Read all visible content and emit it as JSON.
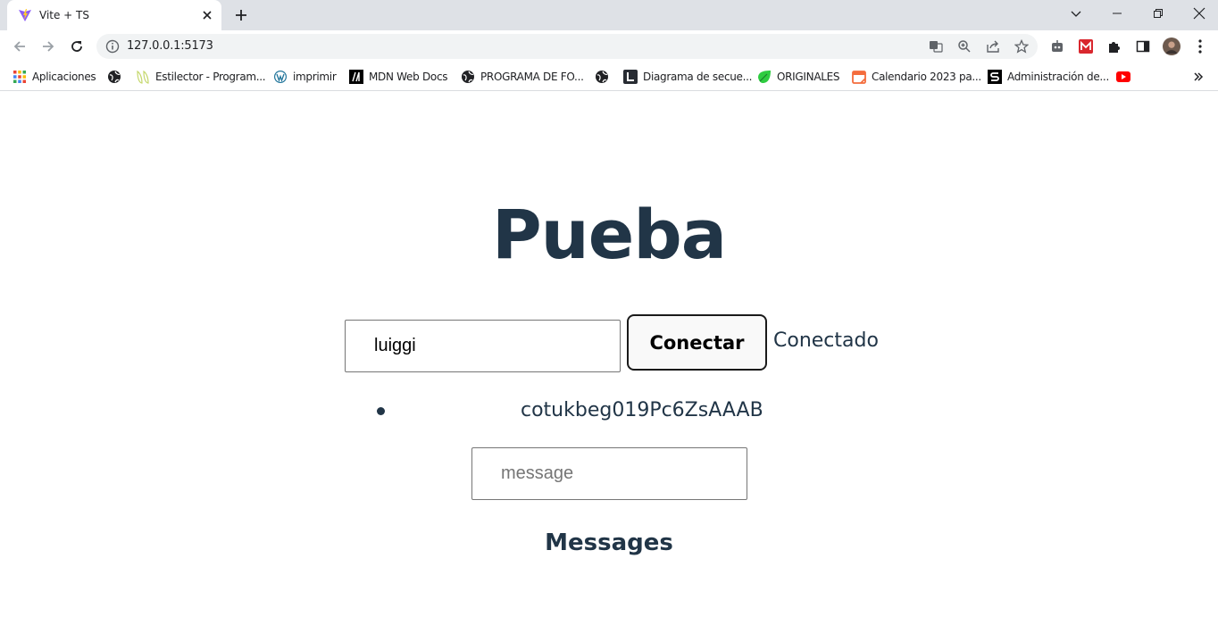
{
  "browser": {
    "tab_title": "Vite + TS",
    "url": "127.0.0.1:5173",
    "bookmarks": [
      {
        "label": "Aplicaciones",
        "icon": "apps-grid-icon"
      },
      {
        "label": "",
        "icon": "globe-icon"
      },
      {
        "label": "Estilector - Program...",
        "icon": "estilector-icon"
      },
      {
        "label": "imprimir",
        "icon": "wordpress-icon"
      },
      {
        "label": "MDN Web Docs",
        "icon": "mdn-icon"
      },
      {
        "label": "PROGRAMA DE FO...",
        "icon": "globe-icon"
      },
      {
        "label": "",
        "icon": "globe-icon"
      },
      {
        "label": "Diagrama de secue...",
        "icon": "lucidchart-icon"
      },
      {
        "label": "ORIGINALES",
        "icon": "leaf-icon"
      },
      {
        "label": "Calendario 2023 pa...",
        "icon": "calendar-icon"
      },
      {
        "label": "Administración de...",
        "icon": "s-logo-icon"
      },
      {
        "label": "",
        "icon": "youtube-icon"
      }
    ]
  },
  "app": {
    "title": "Pueba",
    "name_input_value": "luiggi",
    "connect_label": "Conectar",
    "status": "Conectado",
    "clients": [
      "cotukbeg019Pc6ZsAAAB"
    ],
    "message_placeholder": "message",
    "messages_heading": "Messages"
  },
  "colors": {
    "text": "#213547",
    "chrome_bg": "#dee1e6",
    "button_border": "#1a1a1a"
  }
}
